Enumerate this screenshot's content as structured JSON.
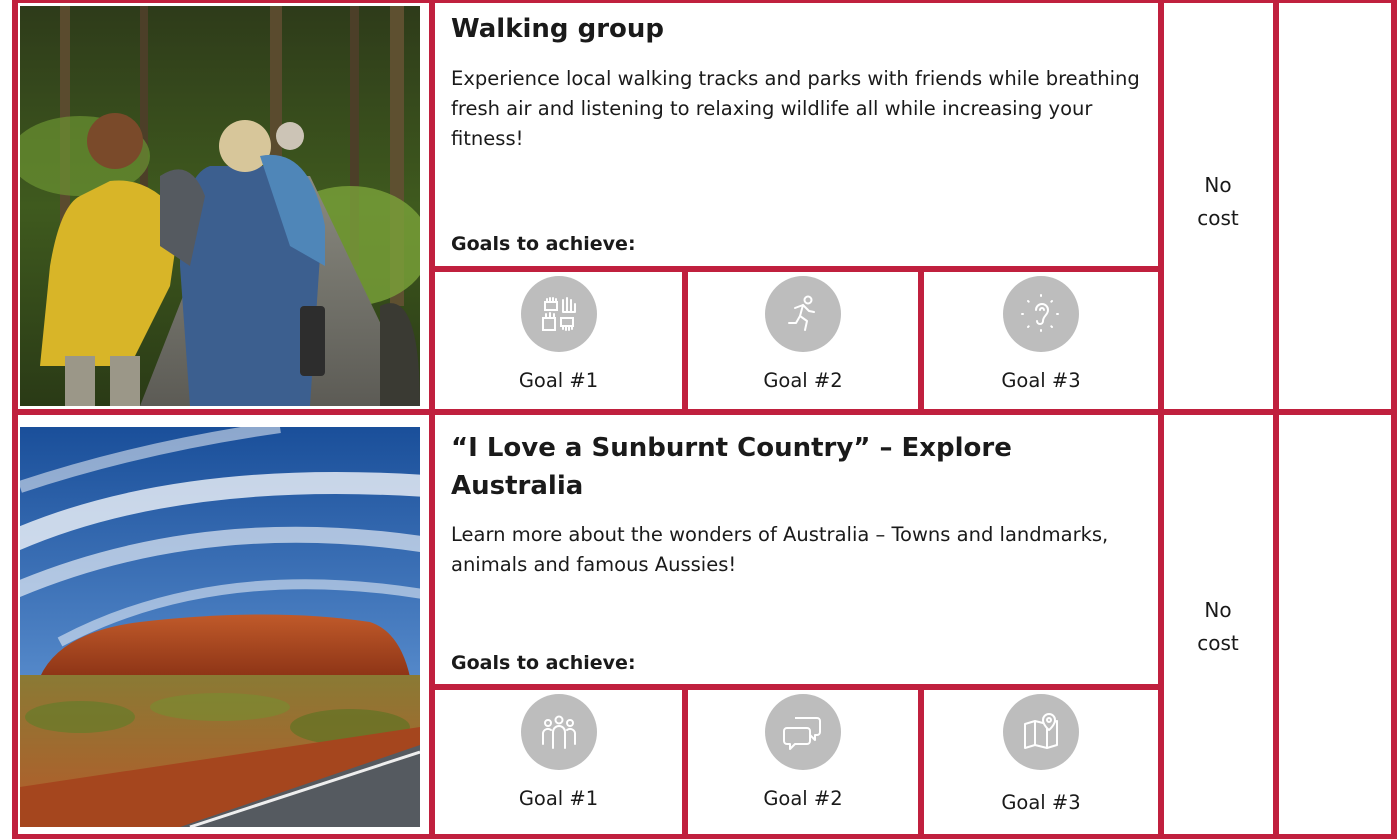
{
  "rows": [
    {
      "title": "Walking group",
      "description": "Experience local walking tracks and parks with friends while breathing fresh air and listening to relaxing wildlife all while increasing your fitness!",
      "goals_label": "Goals to achieve:",
      "goals": [
        {
          "label": "Goal #1",
          "icon": "hands-together-icon"
        },
        {
          "label": "Goal #2",
          "icon": "running-person-icon"
        },
        {
          "label": "Goal #3",
          "icon": "ear-listening-icon"
        }
      ],
      "cost_line1": "No",
      "cost_line2": "cost",
      "photo": "walking-group-photo"
    },
    {
      "title": "“I Love a Sunburnt Country” – Explore Australia",
      "description": "Learn more about the wonders of Australia – Towns and landmarks, animals and famous Aussies!",
      "goals_label": "Goals to achieve:",
      "goals": [
        {
          "label": "Goal #1",
          "icon": "group-people-icon"
        },
        {
          "label": "Goal #2",
          "icon": "speech-bubbles-icon"
        },
        {
          "label": "Goal #3",
          "icon": "map-pin-icon"
        }
      ],
      "cost_line1": "No",
      "cost_line2": "cost",
      "photo": "uluru-photo"
    }
  ],
  "colors": {
    "border": "#c0203e",
    "icon_circle": "#bdbdbd"
  }
}
